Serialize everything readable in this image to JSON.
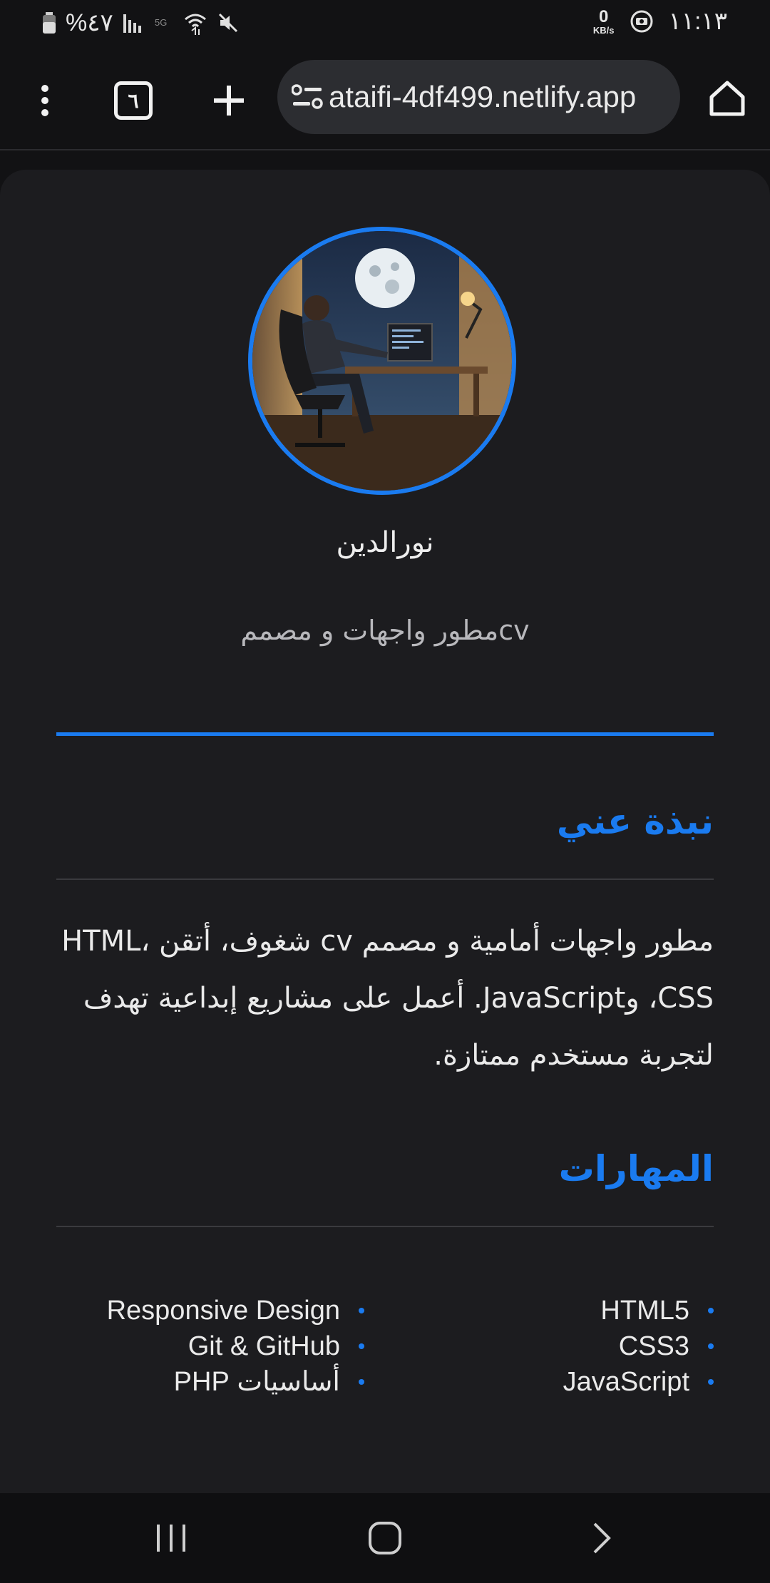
{
  "status_bar": {
    "battery_text": "%٤٧",
    "network_speed_value": "0",
    "network_speed_unit": "KB/s",
    "time": "١١:١٣"
  },
  "browser": {
    "url": "ataifi-4df499.netlify.app",
    "tab_count": "٦"
  },
  "profile": {
    "name": "نورالدين",
    "role": "مطور واجهات و مصممcv"
  },
  "about": {
    "heading": "نبذة عني",
    "text": "مطور واجهات أمامية و مصمم cv شغوف، أتقن HTML، CSS، وJavaScript. أعمل على مشاريع إبداعية تهدف لتجربة مستخدم ممتازة."
  },
  "skills": {
    "heading": "المهارات",
    "column_right": [
      "HTML5",
      "CSS3",
      "JavaScript"
    ],
    "column_left": [
      "Responsive Design",
      "Git & GitHub",
      "أساسيات PHP"
    ]
  },
  "colors": {
    "accent": "#1a7bf0",
    "background": "#1c1c1f"
  }
}
